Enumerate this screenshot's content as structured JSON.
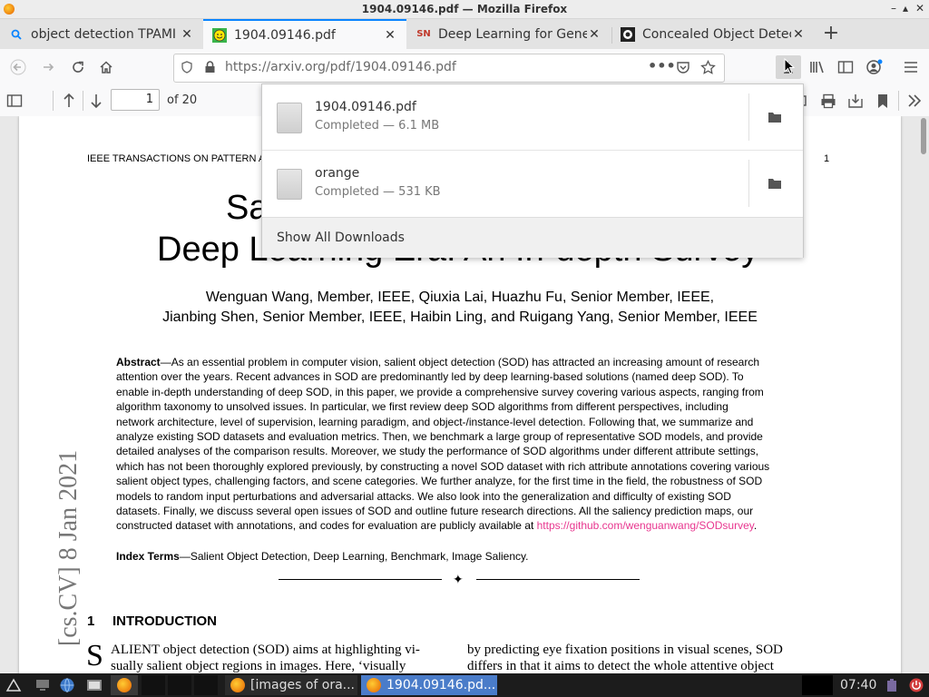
{
  "window": {
    "title": "1904.09146.pdf — Mozilla Firefox",
    "controls": [
      "–",
      "▴",
      "✕"
    ]
  },
  "tabs": [
    {
      "label": "object detection TPAMI journal",
      "icon": "search-icon",
      "active": false
    },
    {
      "label": "1904.09146.pdf",
      "icon": "smiley-icon",
      "active": true
    },
    {
      "label": "Deep Learning for Generic Object Detection",
      "icon": "springer-icon",
      "active": false
    },
    {
      "label": "Concealed Object Detection",
      "icon": "github-icon",
      "active": false
    }
  ],
  "navbar": {
    "url": "https://arxiv.org/pdf/1904.09146.pdf"
  },
  "pdf_toolbar": {
    "page_number": "1",
    "page_count": "of 20"
  },
  "pdf": {
    "header_left": "IEEE TRANSACTIONS ON PATTERN A",
    "header_page": "1",
    "title_line1_left": "Sa",
    "title_line2": "Deep Learning Era: An In-depth Survey",
    "authors_line1": "Wenguan Wang, Member, IEEE, Qiuxia Lai, Huazhu Fu, Senior Member, IEEE,",
    "authors_line2": "Jianbing Shen, Senior Member, IEEE, Haibin Ling, and Ruigang Yang, Senior Member, IEEE",
    "abstract_label": "Abstract",
    "abstract_lines": [
      "—As an essential problem in computer vision, salient object detection (SOD) has attracted an increasing amount of research",
      "attention over the years. Recent advances in SOD are predominantly led by deep learning-based solutions (named deep SOD). To",
      "enable in-depth understanding of deep SOD, in this paper, we provide a comprehensive survey covering various aspects, ranging from",
      "algorithm taxonomy to unsolved issues. In particular, we first review deep SOD algorithms from different perspectives, including",
      "network architecture, level of supervision, learning paradigm, and object-/instance-level detection. Following that, we summarize and",
      "analyze existing SOD datasets and evaluation metrics. Then, we benchmark a large group of representative SOD models, and provide",
      "detailed analyses of the comparison results. Moreover, we study the performance of SOD algorithms under different attribute settings,",
      "which has not been thoroughly explored previously, by constructing a novel SOD dataset with rich attribute annotations covering various",
      "salient object types, challenging factors, and scene categories. We further analyze, for the first time in the field, the robustness of SOD",
      "models to random input perturbations and adversarial attacks. We also look into the generalization and difficulty of existing SOD",
      "datasets. Finally, we discuss several open issues of SOD and outline future research directions. All the saliency prediction maps, our"
    ],
    "abstract_last": "constructed dataset with annotations, and codes for evaluation are publicly available at ",
    "abstract_link": "https://github.com/wenguanwang/SODsurvey",
    "index_label": "Index Terms",
    "index_text": "—Salient Object Detection, Deep Learning, Benchmark, Image Saliency.",
    "section_num": "1",
    "section_title": "INTRODUCTION",
    "col1_line1_dropcap": "S",
    "col1_line1": "ALIENT object detection (SOD) aims at highlighting vi-",
    "col1_line2": "sually salient object regions in images. Here, ‘visually",
    "col2_line1": "by predicting eye fixation positions in visual scenes, SOD",
    "col2_line2": "differs in that it aims to detect the whole attentive object",
    "arxiv_stamp": "[cs.CV]  8 Jan 2021"
  },
  "downloads": {
    "items": [
      {
        "name": "1904.09146.pdf",
        "status": "Completed — 6.1 MB"
      },
      {
        "name": "orange",
        "status": "Completed — 531 KB"
      }
    ],
    "show_all": "Show All Downloads"
  },
  "taskbar": {
    "windows": [
      {
        "label": "[images of ora...",
        "active": false
      },
      {
        "label": "1904.09146.pd...",
        "active": true
      }
    ],
    "clock": "07:40"
  },
  "colors": {
    "accent": "#0a84ff",
    "link": "#e8368f",
    "taskbar": "#1c1c1c"
  }
}
